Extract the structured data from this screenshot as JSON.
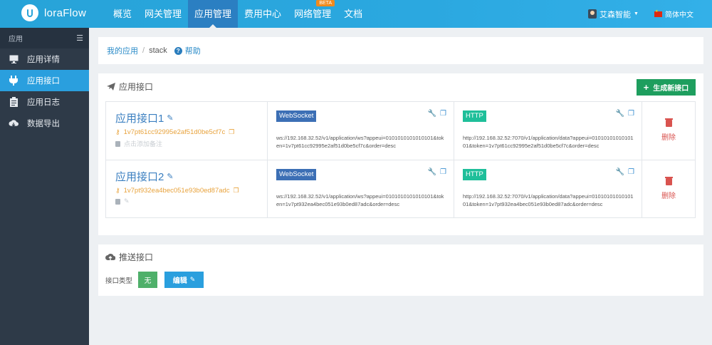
{
  "app": {
    "name": "loraFlow"
  },
  "nav": {
    "items": [
      {
        "label": "概览"
      },
      {
        "label": "网关管理"
      },
      {
        "label": "应用管理"
      },
      {
        "label": "费用中心"
      },
      {
        "label": "网络管理",
        "badge": "BETA"
      },
      {
        "label": "文档"
      }
    ]
  },
  "user": {
    "name": "艾森智能"
  },
  "language": {
    "label": "简体中文"
  },
  "sidebar": {
    "header": "应用",
    "items": [
      {
        "label": "应用详情",
        "icon": "monitor-icon"
      },
      {
        "label": "应用接口",
        "icon": "plug-icon"
      },
      {
        "label": "应用日志",
        "icon": "clipboard-icon"
      },
      {
        "label": "数据导出",
        "icon": "cloud-download-icon"
      }
    ]
  },
  "breadcrumb": {
    "root": "我的应用",
    "separator": "/",
    "current": "stack",
    "help": "帮助"
  },
  "interfaces": {
    "title": "应用接口",
    "create_label": "生成新接口",
    "rows": [
      {
        "name": "应用接口1",
        "token": "1v7pt61cc92995e2af51d0be5cf7c",
        "note": "点击添加备注",
        "ws_tag": "WebSocket",
        "ws_url": "ws://192.168.32.52/v1/application/ws?appeui=0101010101010101&token=1v7pt61cc92995e2af51d0be5cf7c&order=desc",
        "http_tag": "HTTP",
        "http_url": "http://192.168.32.52:7070/v1/application/data?appeui=0101010101010101&token=1v7pt61cc92995e2af51d0be5cf7c&order=desc",
        "delete": "删除"
      },
      {
        "name": "应用接口2",
        "token": "1v7pt932ea4bec051e93b0ed87adc",
        "note": "",
        "ws_tag": "WebSocket",
        "ws_url": "ws://192.168.32.52/v1/application/ws?appeui=0101010101010101&token=1v7pt932ea4bec051e93b0ed87adc&order=desc",
        "http_tag": "HTTP",
        "http_url": "http://192.168.32.52:7070/v1/application/data?appeui=0101010101010101&token=1v7pt932ea4bec051e93b0ed87adc&order=desc",
        "delete": "删除"
      }
    ]
  },
  "push": {
    "title": "推送接口",
    "type_label": "接口类型",
    "type_value": "无",
    "edit_label": "编辑"
  },
  "colors": {
    "primary": "#2a9fde",
    "sidebar": "#2e3a48",
    "success": "#1e9e5e",
    "danger": "#d9534f",
    "token": "#e8a33d"
  }
}
